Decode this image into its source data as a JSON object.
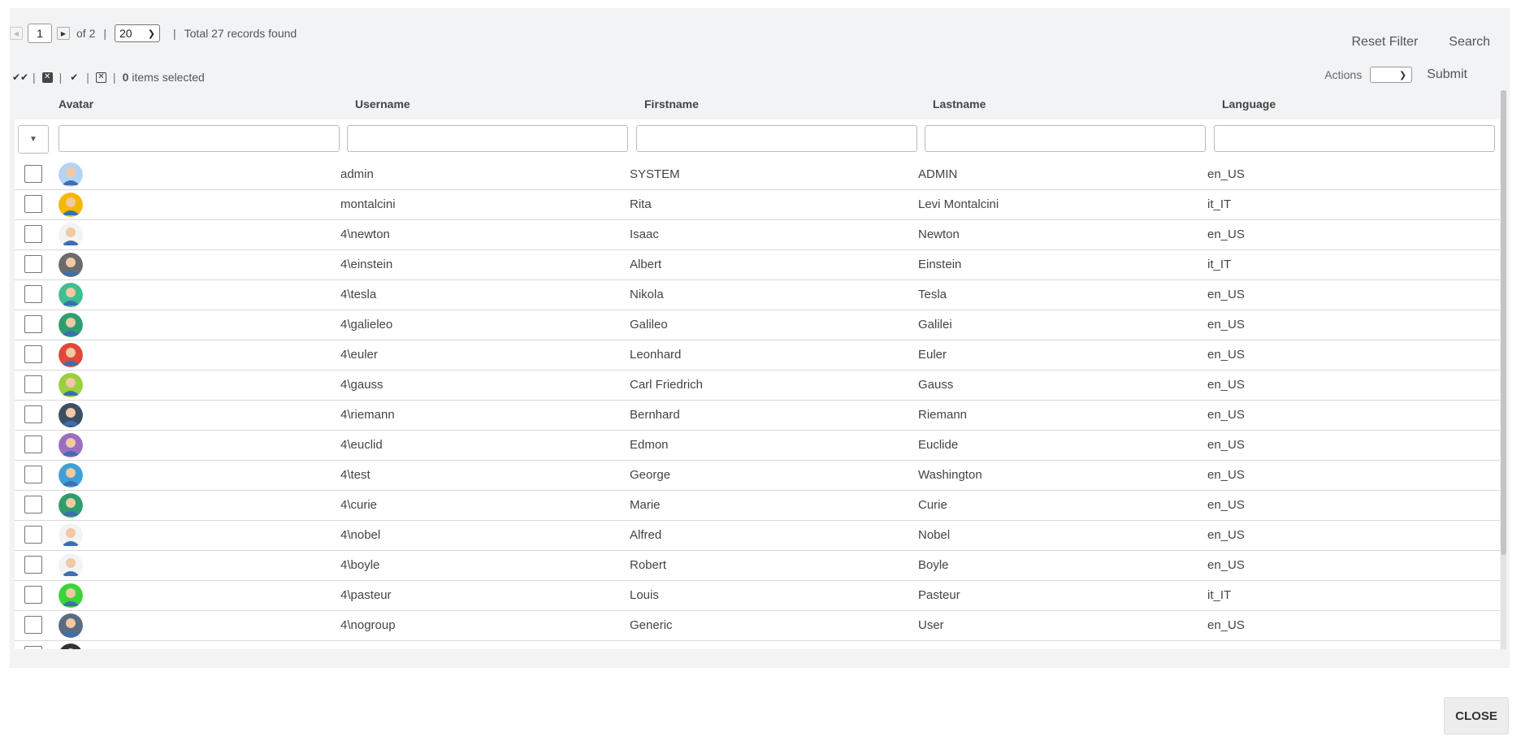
{
  "pagination": {
    "page": "1",
    "of_label": "of 2",
    "page_size": "20",
    "total_label": "Total 27 records found"
  },
  "toolbar": {
    "reset_filter": "Reset Filter",
    "search": "Search"
  },
  "selection": {
    "count": "0",
    "label": "items selected"
  },
  "actions": {
    "label": "Actions",
    "submit": "Submit"
  },
  "columns": {
    "avatar": "Avatar",
    "username": "Username",
    "firstname": "Firstname",
    "lastname": "Lastname",
    "language": "Language"
  },
  "rows": [
    {
      "username": "admin",
      "firstname": "SYSTEM",
      "lastname": "ADMIN",
      "language": "en_US",
      "avatar_color": "#b5d4f5"
    },
    {
      "username": "montalcini",
      "firstname": "Rita",
      "lastname": "Levi Montalcini",
      "language": "it_IT",
      "avatar_color": "#f5b800"
    },
    {
      "username": "4\\newton",
      "firstname": "Isaac",
      "lastname": "Newton",
      "language": "en_US",
      "avatar_color": "#f3f3f3"
    },
    {
      "username": "4\\einstein",
      "firstname": "Albert",
      "lastname": "Einstein",
      "language": "it_IT",
      "avatar_color": "#6b6b6b"
    },
    {
      "username": "4\\tesla",
      "firstname": "Nikola",
      "lastname": "Tesla",
      "language": "en_US",
      "avatar_color": "#3fbf8f"
    },
    {
      "username": "4\\galieleo",
      "firstname": "Galileo",
      "lastname": "Galilei",
      "language": "en_US",
      "avatar_color": "#2e9e6e"
    },
    {
      "username": "4\\euler",
      "firstname": "Leonhard",
      "lastname": "Euler",
      "language": "en_US",
      "avatar_color": "#e0483a"
    },
    {
      "username": "4\\gauss",
      "firstname": "Carl Friedrich",
      "lastname": "Gauss",
      "language": "en_US",
      "avatar_color": "#9bcf3f"
    },
    {
      "username": "4\\riemann",
      "firstname": "Bernhard",
      "lastname": "Riemann",
      "language": "en_US",
      "avatar_color": "#3d4f63"
    },
    {
      "username": "4\\euclid",
      "firstname": "Edmon",
      "lastname": "Euclide",
      "language": "en_US",
      "avatar_color": "#9a6fbf"
    },
    {
      "username": "4\\test",
      "firstname": "George",
      "lastname": "Washington",
      "language": "en_US",
      "avatar_color": "#3fa0d6"
    },
    {
      "username": "4\\curie",
      "firstname": "Marie",
      "lastname": "Curie",
      "language": "en_US",
      "avatar_color": "#2e9e6e"
    },
    {
      "username": "4\\nobel",
      "firstname": "Alfred",
      "lastname": "Nobel",
      "language": "en_US",
      "avatar_color": "#f3f3f3"
    },
    {
      "username": "4\\boyle",
      "firstname": "Robert",
      "lastname": "Boyle",
      "language": "en_US",
      "avatar_color": "#f3f3f3"
    },
    {
      "username": "4\\pasteur",
      "firstname": "Louis",
      "lastname": "Pasteur",
      "language": "it_IT",
      "avatar_color": "#3ad43a"
    },
    {
      "username": "4\\nogroup",
      "firstname": "Generic",
      "lastname": "User",
      "language": "en_US",
      "avatar_color": "#5b6b80"
    },
    {
      "username": "",
      "firstname": "",
      "lastname": "",
      "language": "",
      "avatar_color": "#333333"
    }
  ],
  "close_label": "CLOSE"
}
